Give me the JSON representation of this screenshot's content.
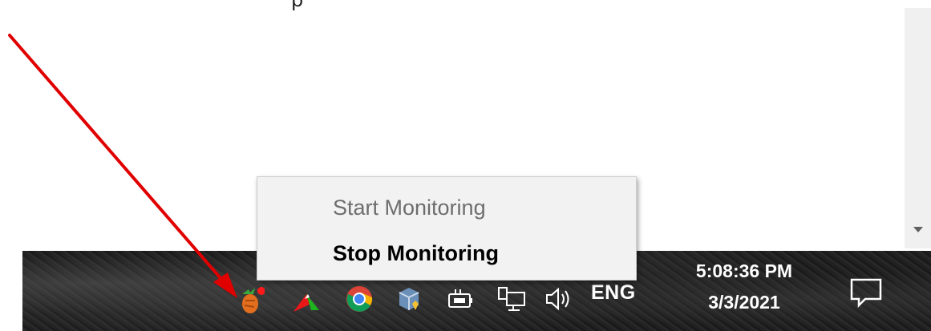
{
  "top_fragment": "p",
  "context_menu": {
    "items": [
      {
        "label": "Start Monitoring",
        "enabled": false
      },
      {
        "label": "Stop Monitoring",
        "enabled": true
      }
    ]
  },
  "taskbar": {
    "tray_icons": [
      "monitoring-app-icon",
      "red-green-app-icon",
      "chrome-icon",
      "virtualbox-icon",
      "battery-plug-icon",
      "network-icon",
      "volume-icon"
    ],
    "language": "ENG",
    "clock": {
      "time": "5:08:36 PM",
      "date": "3/3/2021"
    },
    "notification_icon": "action-center-icon"
  },
  "colors": {
    "annotation_arrow": "#e00000",
    "taskbar_bg": "#1e1e1e",
    "menu_bg": "#f2f2f2",
    "menu_disabled_text": "#6d6d6d"
  }
}
